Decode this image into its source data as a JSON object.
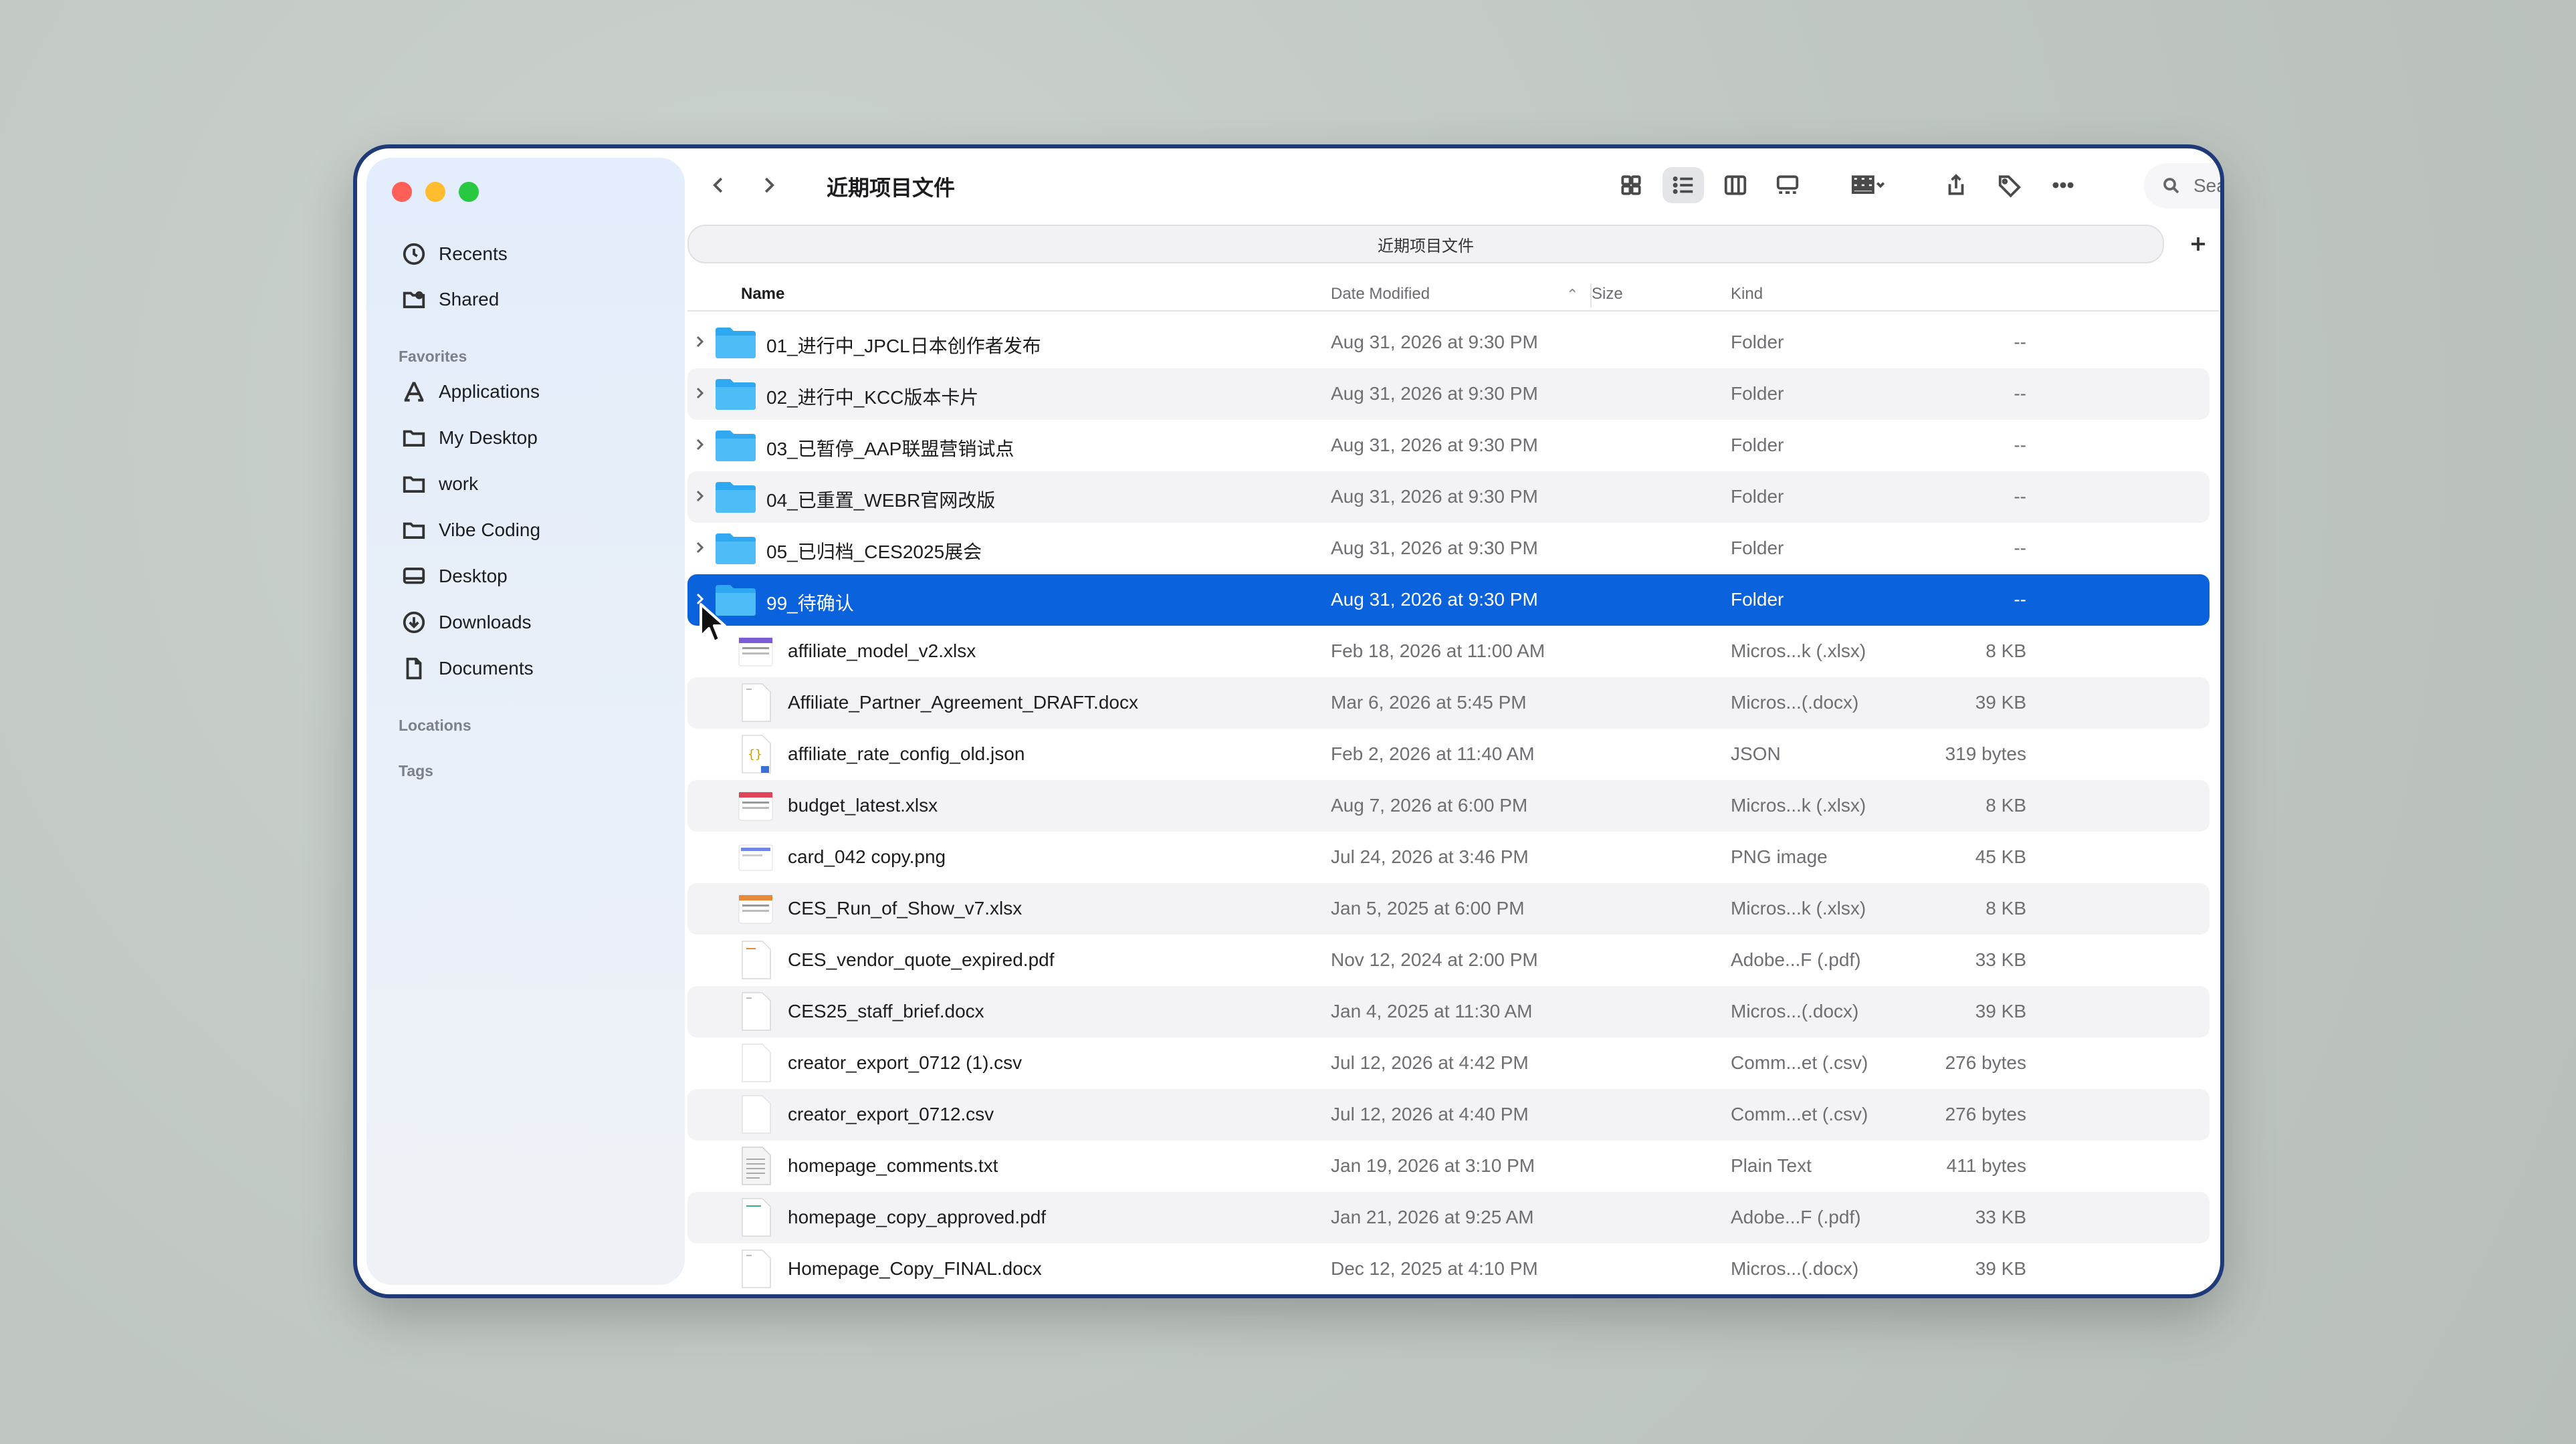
{
  "window": {
    "title": "近期项目文件"
  },
  "sidebar": {
    "top_items": [
      {
        "label": "Recents",
        "icon": "clock-icon"
      },
      {
        "label": "Shared",
        "icon": "shared-folder-icon"
      }
    ],
    "favorites_heading": "Favorites",
    "favorites": [
      {
        "label": "Applications",
        "icon": "applications-icon"
      },
      {
        "label": "My Desktop",
        "icon": "folder-icon"
      },
      {
        "label": "work",
        "icon": "folder-icon"
      },
      {
        "label": "Vibe Coding",
        "icon": "folder-icon"
      },
      {
        "label": "Desktop",
        "icon": "desktop-icon"
      },
      {
        "label": "Downloads",
        "icon": "download-icon"
      },
      {
        "label": "Documents",
        "icon": "document-icon"
      }
    ],
    "locations_heading": "Locations",
    "tags_heading": "Tags"
  },
  "toolbar": {
    "search_placeholder": "Search"
  },
  "pathbar": {
    "label": "近期项目文件"
  },
  "columns": {
    "name": "Name",
    "date": "Date Modified",
    "size": "Size",
    "kind": "Kind"
  },
  "rows": [
    {
      "name": "01_进行中_JPCL日本创作者发布",
      "date": "Aug 31, 2026 at 9:30 PM",
      "size": "--",
      "kind": "Folder",
      "type": "folder"
    },
    {
      "name": "02_进行中_KCC版本卡片",
      "date": "Aug 31, 2026 at 9:30 PM",
      "size": "--",
      "kind": "Folder",
      "type": "folder"
    },
    {
      "name": "03_已暂停_AAP联盟营销试点",
      "date": "Aug 31, 2026 at 9:30 PM",
      "size": "--",
      "kind": "Folder",
      "type": "folder"
    },
    {
      "name": "04_已重置_WEBR官网改版",
      "date": "Aug 31, 2026 at 9:30 PM",
      "size": "--",
      "kind": "Folder",
      "type": "folder"
    },
    {
      "name": "05_已归档_CES2025展会",
      "date": "Aug 31, 2026 at 9:30 PM",
      "size": "--",
      "kind": "Folder",
      "type": "folder"
    },
    {
      "name": "99_待确认",
      "date": "Aug 31, 2026 at 9:30 PM",
      "size": "--",
      "kind": "Folder",
      "type": "folder",
      "selected": true
    },
    {
      "name": "affiliate_model_v2.xlsx",
      "date": "Feb 18, 2026 at 11:00 AM",
      "size": "8 KB",
      "kind": "Micros...k (.xlsx)",
      "type": "xlsx-purple"
    },
    {
      "name": "Affiliate_Partner_Agreement_DRAFT.docx",
      "date": "Mar 6, 2026 at 5:45 PM",
      "size": "39 KB",
      "kind": "Micros...(.docx)",
      "type": "doc"
    },
    {
      "name": "affiliate_rate_config_old.json",
      "date": "Feb 2, 2026 at 11:40 AM",
      "size": "319 bytes",
      "kind": "JSON",
      "type": "json"
    },
    {
      "name": "budget_latest.xlsx",
      "date": "Aug 7, 2026 at 6:00 PM",
      "size": "8 KB",
      "kind": "Micros...k (.xlsx)",
      "type": "xlsx-red"
    },
    {
      "name": "card_042 copy.png",
      "date": "Jul 24, 2026 at 3:46 PM",
      "size": "45 KB",
      "kind": "PNG image",
      "type": "png"
    },
    {
      "name": "CES_Run_of_Show_v7.xlsx",
      "date": "Jan 5, 2025 at 6:00 PM",
      "size": "8 KB",
      "kind": "Micros...k (.xlsx)",
      "type": "xlsx-orange"
    },
    {
      "name": "CES_vendor_quote_expired.pdf",
      "date": "Nov 12, 2024 at 2:00 PM",
      "size": "33 KB",
      "kind": "Adobe...F (.pdf)",
      "type": "pdf-orange"
    },
    {
      "name": "CES25_staff_brief.docx",
      "date": "Jan 4, 2025 at 11:30 AM",
      "size": "39 KB",
      "kind": "Micros...(.docx)",
      "type": "doc"
    },
    {
      "name": "creator_export_0712 (1).csv",
      "date": "Jul 12, 2026 at 4:42 PM",
      "size": "276 bytes",
      "kind": "Comm...et (.csv)",
      "type": "blank"
    },
    {
      "name": "creator_export_0712.csv",
      "date": "Jul 12, 2026 at 4:40 PM",
      "size": "276 bytes",
      "kind": "Comm...et (.csv)",
      "type": "blank"
    },
    {
      "name": "homepage_comments.txt",
      "date": "Jan 19, 2026 at 3:10 PM",
      "size": "411 bytes",
      "kind": "Plain Text",
      "type": "txt"
    },
    {
      "name": "homepage_copy_approved.pdf",
      "date": "Jan 21, 2026 at 9:25 AM",
      "size": "33 KB",
      "kind": "Adobe...F (.pdf)",
      "type": "pdf-green"
    },
    {
      "name": "Homepage_Copy_FINAL.docx",
      "date": "Dec 12, 2025 at 4:10 PM",
      "size": "39 KB",
      "kind": "Micros...(.docx)",
      "type": "doc"
    }
  ]
}
